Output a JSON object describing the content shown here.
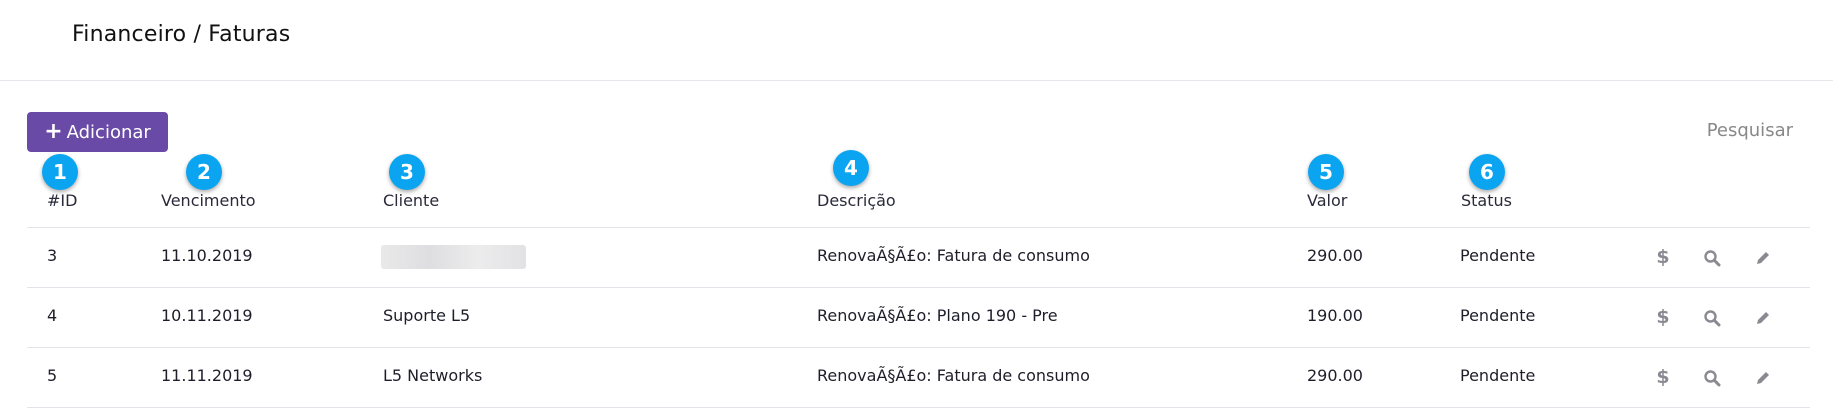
{
  "breadcrumb": "Financeiro / Faturas",
  "toolbar": {
    "add_label": "Adicionar",
    "search_label": "Pesquisar"
  },
  "badges": [
    "1",
    "2",
    "3",
    "4",
    "5",
    "6"
  ],
  "columns": [
    "#ID",
    "Vencimento",
    "Cliente",
    "Descrição",
    "Valor",
    "Status"
  ],
  "rows": [
    {
      "id": "3",
      "vencimento": "11.10.2019",
      "cliente": "",
      "descricao": "RenovaÃ§Ã£o: Fatura de consumo",
      "valor": "290.00",
      "status": "Pendente"
    },
    {
      "id": "4",
      "vencimento": "10.11.2019",
      "cliente": "Suporte L5",
      "descricao": "RenovaÃ§Ã£o: Plano 190 - Pre",
      "valor": "190.00",
      "status": "Pendente"
    },
    {
      "id": "5",
      "vencimento": "11.11.2019",
      "cliente": "L5 Networks",
      "descricao": "RenovaÃ§Ã£o: Fatura de consumo",
      "valor": "290.00",
      "status": "Pendente"
    }
  ],
  "actions": [
    "dollar-icon",
    "search-icon",
    "pencil-icon"
  ],
  "colors": {
    "accent": "#6a4aa7",
    "badge": "#0aa4f0"
  }
}
